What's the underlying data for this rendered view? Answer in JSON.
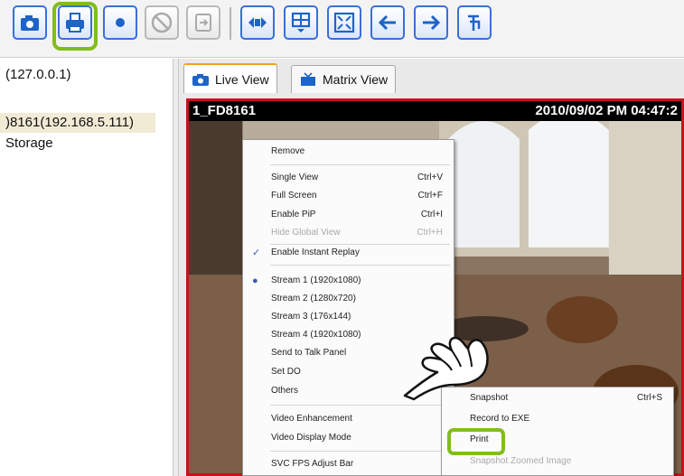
{
  "toolbar": {
    "buttons": [
      {
        "icon": "camera-icon",
        "enabled": true
      },
      {
        "icon": "print-icon",
        "enabled": true,
        "highlighted": true
      },
      {
        "icon": "record-dot-icon",
        "enabled": true
      },
      {
        "icon": "no-entry-icon",
        "enabled": false
      },
      {
        "icon": "export-icon",
        "enabled": false
      },
      {
        "icon": "ptz-icon",
        "enabled": true
      },
      {
        "icon": "matrix-layout-icon",
        "enabled": true
      },
      {
        "icon": "fullscreen-icon",
        "enabled": true
      },
      {
        "icon": "arrow-left-icon",
        "enabled": true
      },
      {
        "icon": "arrow-right-icon",
        "enabled": true
      },
      {
        "icon": "patrol-icon",
        "enabled": true
      }
    ],
    "accent_color": "#3a6fd8",
    "highlight_color": "#82bd1a"
  },
  "tree": {
    "items": [
      {
        "label": "(127.0.0.1)",
        "selected": false
      },
      {
        "label": ")8161(192.168.5.111)",
        "selected": true
      },
      {
        "label": "Storage",
        "selected": false
      }
    ]
  },
  "tabs": [
    {
      "label": "Live View",
      "icon": "camera-icon",
      "active": true
    },
    {
      "label": "Matrix View",
      "icon": "matrix-view-icon",
      "active": false
    }
  ],
  "video": {
    "camera_name": "1_FD8161",
    "timestamp": "2010/09/02 PM 04:47:2",
    "border_color": "#c2141c"
  },
  "context_menu": {
    "items": [
      {
        "label": "Remove",
        "shortcut": "",
        "enabled": true,
        "mark": ""
      },
      {
        "label": "Single View",
        "shortcut": "Ctrl+V",
        "enabled": true,
        "mark": ""
      },
      {
        "label": "Full Screen",
        "shortcut": "Ctrl+F",
        "enabled": true,
        "mark": ""
      },
      {
        "label": "Enable PiP",
        "shortcut": "Ctrl+I",
        "enabled": true,
        "mark": ""
      },
      {
        "label": "Hide Global View",
        "shortcut": "Ctrl+H",
        "enabled": false,
        "mark": ""
      },
      {
        "label": "Enable Instant Replay",
        "shortcut": "",
        "enabled": true,
        "mark": "✓"
      },
      {
        "label": "Stream 1 (1920x1080)",
        "shortcut": "",
        "enabled": true,
        "mark": "●"
      },
      {
        "label": "Stream 2 (1280x720)",
        "shortcut": "",
        "enabled": true,
        "mark": ""
      },
      {
        "label": "Stream 3 (176x144)",
        "shortcut": "",
        "enabled": true,
        "mark": ""
      },
      {
        "label": "Stream 4 (1920x1080)",
        "shortcut": "",
        "enabled": true,
        "mark": ""
      },
      {
        "label": "Send to Talk Panel",
        "shortcut": "",
        "enabled": true,
        "mark": ""
      },
      {
        "label": "Set DO",
        "shortcut": "",
        "enabled": true,
        "mark": ""
      },
      {
        "label": "Others",
        "shortcut": "",
        "enabled": true,
        "mark": ""
      },
      {
        "label": "Video Enhancement",
        "shortcut": "",
        "enabled": true,
        "mark": ""
      },
      {
        "label": "Video Display Mode",
        "shortcut": "",
        "enabled": true,
        "mark": ""
      },
      {
        "label": "SVC FPS Adjust Bar",
        "shortcut": "",
        "enabled": true,
        "mark": ""
      }
    ]
  },
  "submenu": {
    "items": [
      {
        "label": "Snapshot",
        "shortcut": "Ctrl+S",
        "enabled": true
      },
      {
        "label": "Record to EXE",
        "shortcut": "",
        "enabled": true
      },
      {
        "label": "Print",
        "shortcut": "",
        "enabled": true,
        "highlighted": true
      },
      {
        "label": "Snapshot Zoomed Image",
        "shortcut": "",
        "enabled": false
      }
    ]
  }
}
